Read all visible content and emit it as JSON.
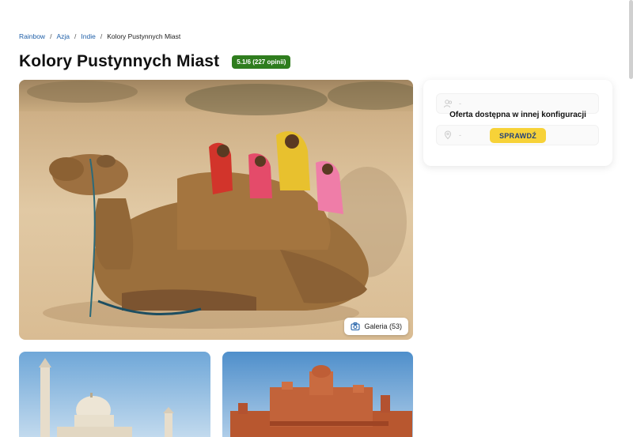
{
  "breadcrumb": {
    "items": [
      "Rainbow",
      "Azja",
      "Indie"
    ],
    "current": "Kolory Pustynnych Miast",
    "separator": "/"
  },
  "header": {
    "title": "Kolory Pustynnych Miast",
    "rating": "5.1/6 (227 opinii)"
  },
  "gallery": {
    "label": "Galeria (53)",
    "icon": "camera-icon"
  },
  "offer": {
    "message": "Oferta dostępna w innej konfiguracji",
    "button": "SPRAWDŹ",
    "row1_value": "-",
    "row2_value": "-",
    "row1_icon": "travelers-icon",
    "row2_icon": "location-icon"
  },
  "colors": {
    "link": "#1f5fa8",
    "rating_badge": "#2f7d1e",
    "cta": "#f7d238",
    "cta_text": "#22407a"
  }
}
